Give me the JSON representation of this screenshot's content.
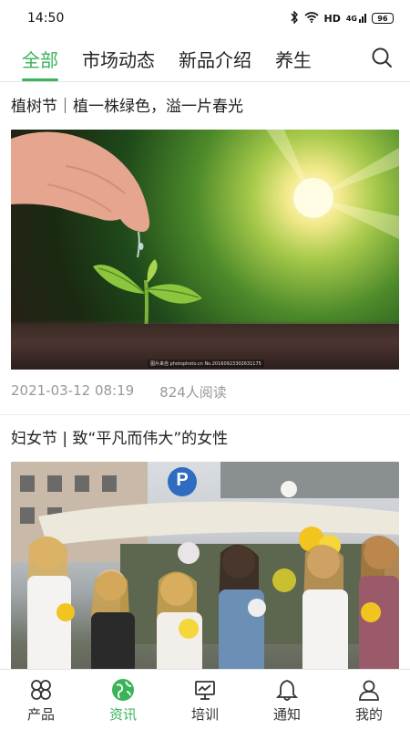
{
  "status_bar": {
    "time": "14:50",
    "network": "HD",
    "signal": "4G",
    "battery": "96"
  },
  "tabs": [
    {
      "label": "全部",
      "active": true
    },
    {
      "label": "市场动态",
      "active": false
    },
    {
      "label": "新品介绍",
      "active": false
    },
    {
      "label": "养生",
      "active": false
    }
  ],
  "colors": {
    "accent": "#3bb35a",
    "text": "#222222",
    "meta": "#999999"
  },
  "articles": [
    {
      "title": "植树节｜植一株绿色，溢一片春光",
      "image": "sprout-watering-image",
      "image_watermark": "图片来自 photophoto.cn No.20160923302631175",
      "date": "2021-03-12 08:19",
      "reads": "824人阅读"
    },
    {
      "title": "妇女节 | 致“平凡而伟大”的女性",
      "image": "women-with-flowers-image",
      "image_sign": "P"
    }
  ],
  "bottom_nav": [
    {
      "label": "产品",
      "icon": "clover-icon",
      "active": false
    },
    {
      "label": "资讯",
      "icon": "globe-icon",
      "active": true
    },
    {
      "label": "培训",
      "icon": "presentation-icon",
      "active": false
    },
    {
      "label": "通知",
      "icon": "bell-icon",
      "active": false
    },
    {
      "label": "我的",
      "icon": "person-icon",
      "active": false
    }
  ]
}
